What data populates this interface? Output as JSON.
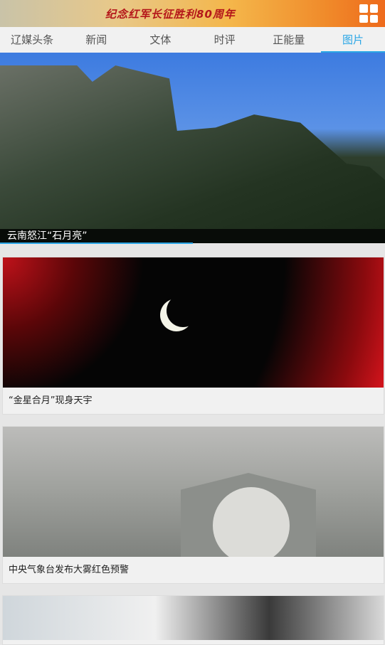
{
  "banner": {
    "title": "纪念红军长征胜利80周年",
    "menu_icon": "grid-icon"
  },
  "tabs": [
    {
      "label": "辽媒头条",
      "active": false
    },
    {
      "label": "新闻",
      "active": false
    },
    {
      "label": "文体",
      "active": false
    },
    {
      "label": "时评",
      "active": false
    },
    {
      "label": "正能量",
      "active": false
    },
    {
      "label": "图片",
      "active": true
    }
  ],
  "hero": {
    "caption": "云南怒江“石月亮”",
    "carousel_progress": 0.5
  },
  "cards": [
    {
      "caption": "“金星合月”现身天宇"
    },
    {
      "caption": "中央气象台发布大雾红色预警"
    }
  ],
  "colors": {
    "accent": "#2aa6e6",
    "banner_text": "#b4161a"
  }
}
